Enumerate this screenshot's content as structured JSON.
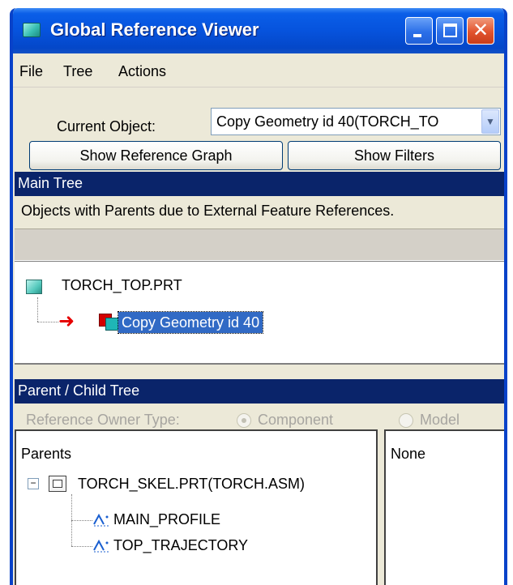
{
  "window": {
    "title": "Global Reference Viewer"
  },
  "menu": [
    "File",
    "Tree",
    "Actions"
  ],
  "current_object": {
    "label": "Current Object:",
    "value": "Copy Geometry id 40(TORCH_TO"
  },
  "buttons": {
    "show_graph": "Show Reference Graph",
    "show_filters": "Show Filters"
  },
  "main_tree": {
    "header": "Main Tree",
    "description": "Objects with Parents due to External Feature References.",
    "root": "TORCH_TOP.PRT",
    "child": "Copy Geometry id 40"
  },
  "parent_child": {
    "header": "Parent / Child Tree",
    "owner_type_label": "Reference Owner Type:",
    "options": [
      "Component",
      "Model"
    ],
    "selected_option": "Component",
    "parents_title": "Parents",
    "parent_node": "TORCH_SKEL.PRT(TORCH.ASM)",
    "parent_children": [
      "MAIN_PROFILE",
      "TOP_TRAJECTORY"
    ],
    "children_title": "None"
  },
  "colors": {
    "selection": "#316ac5",
    "section_bar": "#0a246a",
    "titlebar": "#0653dd",
    "reference_arrow": "#e60000"
  }
}
